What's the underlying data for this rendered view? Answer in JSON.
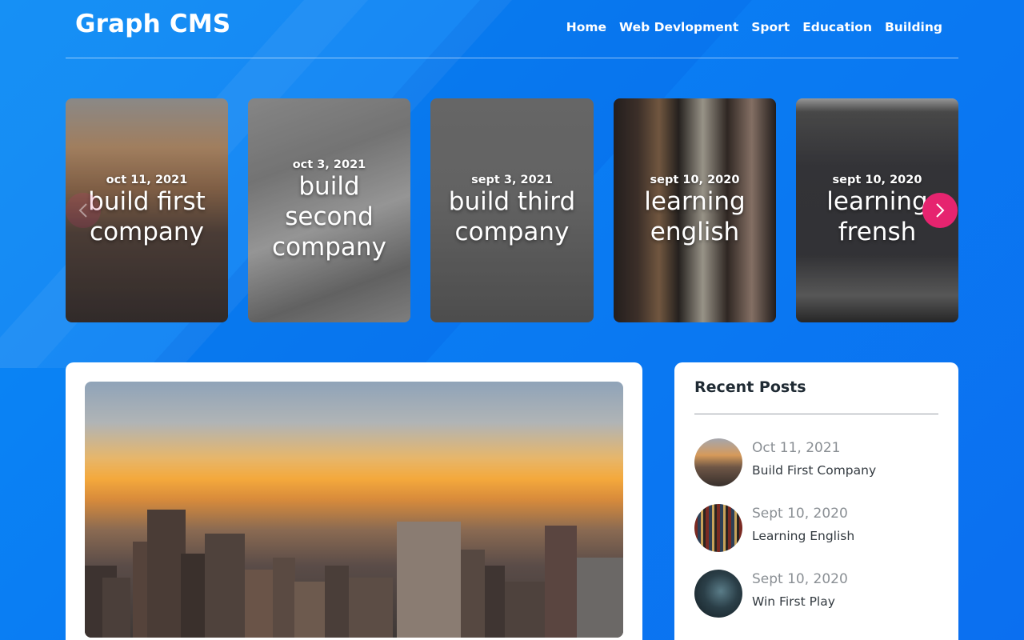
{
  "brand": "Graph CMS",
  "nav": [
    "Home",
    "Web Devlopment",
    "Sport",
    "Education",
    "Building"
  ],
  "carousel": [
    {
      "date": "oct 11, 2021",
      "title": "build first company"
    },
    {
      "date": "oct 3, 2021",
      "title": "build second company"
    },
    {
      "date": "sept 3, 2021",
      "title": "build third company"
    },
    {
      "date": "sept 10, 2020",
      "title": "learning english"
    },
    {
      "date": "sept 10, 2020",
      "title": "learning frensh"
    }
  ],
  "carousel_controls": {
    "prev_icon": "chevron-left-icon",
    "next_icon": "chevron-right-icon"
  },
  "sidebar": {
    "title": "Recent Posts",
    "items": [
      {
        "date": "Oct 11, 2021",
        "title": "Build First Company"
      },
      {
        "date": "Sept 10, 2020",
        "title": "Learning English"
      },
      {
        "date": "Sept 10, 2020",
        "title": "Win First Play"
      }
    ]
  },
  "colors": {
    "background": "#0a7df3",
    "accent": "#e6246f",
    "card": "#ffffff"
  }
}
